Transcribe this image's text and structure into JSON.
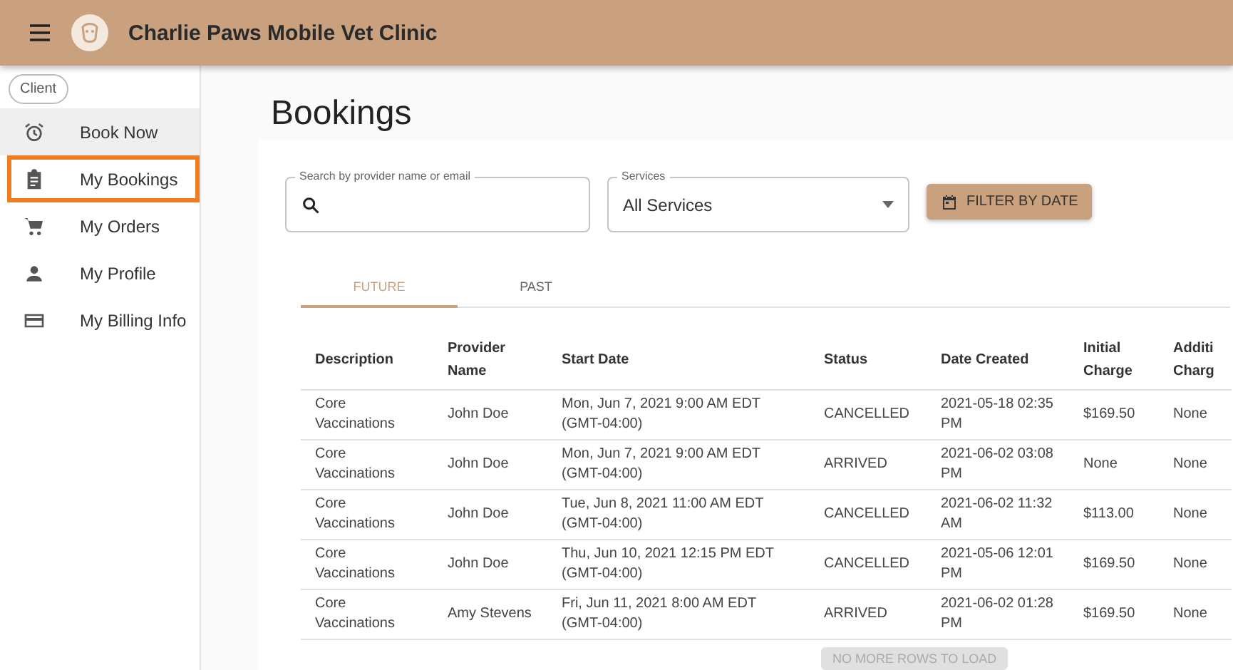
{
  "app_bar": {
    "title": "Charlie Paws Mobile Vet Clinic"
  },
  "sidebar": {
    "role_chip": "Client",
    "items": [
      {
        "label": "Book Now",
        "kind": "alarm",
        "selected": false,
        "hovered": true
      },
      {
        "label": "My Bookings",
        "kind": "clipboard",
        "selected": true,
        "hovered": false
      },
      {
        "label": "My Orders",
        "kind": "cart",
        "selected": false,
        "hovered": false
      },
      {
        "label": "My Profile",
        "kind": "person",
        "selected": false,
        "hovered": false
      },
      {
        "label": "My Billing Info",
        "kind": "card",
        "selected": false,
        "hovered": false
      }
    ]
  },
  "page_title": "Bookings",
  "search": {
    "label": "Search by provider name or email"
  },
  "services": {
    "label": "Services",
    "value": "All Services"
  },
  "filter_button": "FILTER BY DATE",
  "tabs": [
    {
      "label": "FUTURE",
      "selected": true
    },
    {
      "label": "PAST",
      "selected": false
    }
  ],
  "table": {
    "columns": [
      "Description",
      "Provider Name",
      "Start Date",
      "Status",
      "Date Created",
      "Initial Charge",
      "Additi Charg"
    ],
    "rows": [
      [
        "Core Vaccinations",
        "John Doe",
        "Mon, Jun 7, 2021 9:00 AM EDT (GMT-04:00)",
        "CANCELLED",
        "2021-05-18 02:35 PM",
        "$169.50",
        "None"
      ],
      [
        "Core Vaccinations",
        "John Doe",
        "Mon, Jun 7, 2021 9:00 AM EDT (GMT-04:00)",
        "ARRIVED",
        "2021-06-02 03:08 PM",
        "None",
        "None"
      ],
      [
        "Core Vaccinations",
        "John Doe",
        "Tue, Jun 8, 2021 11:00 AM EDT (GMT-04:00)",
        "CANCELLED",
        "2021-06-02 11:32 AM",
        "$113.00",
        "None"
      ],
      [
        "Core Vaccinations",
        "John Doe",
        "Thu, Jun 10, 2021 12:15 PM EDT (GMT-04:00)",
        "CANCELLED",
        "2021-05-06 12:01 PM",
        "$169.50",
        "None"
      ],
      [
        "Core Vaccinations",
        "Amy Stevens",
        "Fri, Jun 11, 2021 8:00 AM EDT (GMT-04:00)",
        "ARRIVED",
        "2021-06-02 01:28 PM",
        "$169.50",
        "None"
      ]
    ]
  },
  "load_more": {
    "label": "NO MORE ROWS TO LOAD",
    "disabled": true
  }
}
